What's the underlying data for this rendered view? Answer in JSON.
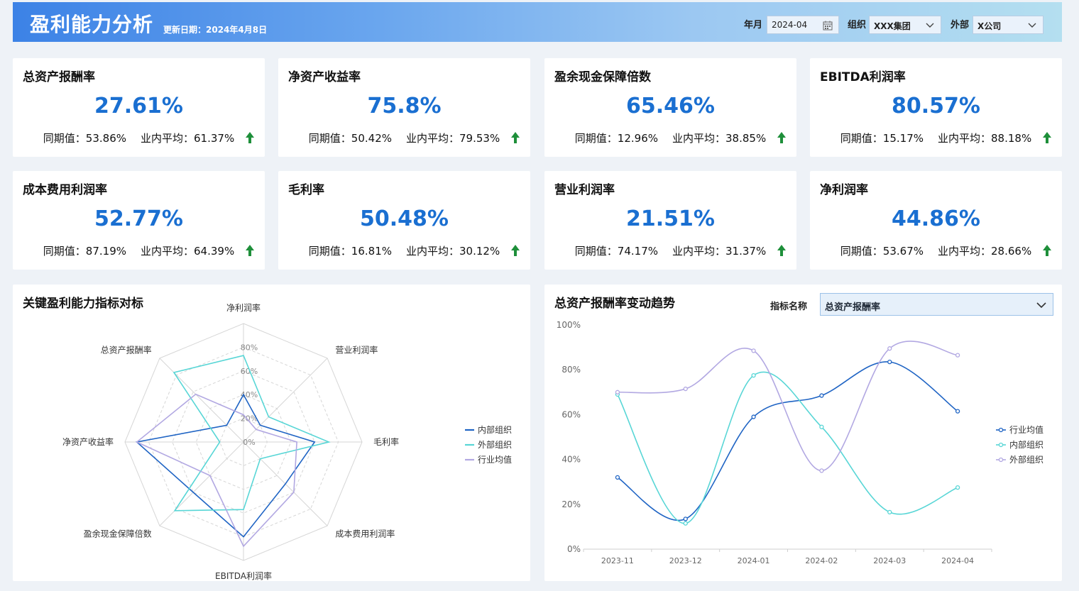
{
  "header": {
    "title": "盈利能力分析",
    "update_text": "更新日期：2024年4月8日",
    "filters": [
      {
        "label": "年月",
        "value": "2024-04",
        "icon": "calendar-icon"
      },
      {
        "label": "组织",
        "value": "XXX集团",
        "icon": "chevron-down-icon"
      },
      {
        "label": "外部",
        "value": "X公司",
        "icon": "chevron-down-icon"
      }
    ]
  },
  "kpis": [
    {
      "name": "总资产报酬率",
      "value": "27.61%",
      "prev": "同期值：53.86%",
      "avg": "业内平均：61.37%",
      "trend": "up"
    },
    {
      "name": "净资产收益率",
      "value": "75.8%",
      "prev": "同期值：50.42%",
      "avg": "业内平均：79.53%",
      "trend": "up"
    },
    {
      "name": "盈余现金保障倍数",
      "value": "65.46%",
      "prev": "同期值：12.96%",
      "avg": "业内平均：38.85%",
      "trend": "up"
    },
    {
      "name": "EBITDA利润率",
      "value": "80.57%",
      "prev": "同期值：15.17%",
      "avg": "业内平均：88.18%",
      "trend": "up"
    },
    {
      "name": "成本费用利润率",
      "value": "52.77%",
      "prev": "同期值：87.19%",
      "avg": "业内平均：64.39%",
      "trend": "up"
    },
    {
      "name": "毛利率",
      "value": "50.48%",
      "prev": "同期值：16.81%",
      "avg": "业内平均：30.12%",
      "trend": "up"
    },
    {
      "name": "营业利润率",
      "value": "21.51%",
      "prev": "同期值：74.17%",
      "avg": "业内平均：31.37%",
      "trend": "up"
    },
    {
      "name": "净利润率",
      "value": "44.86%",
      "prev": "同期值：53.67%",
      "avg": "业内平均：28.66%",
      "trend": "up"
    }
  ],
  "colors": {
    "accent": "#1a6fd1",
    "up": "#1e8f3a",
    "dark_blue": "#1f64c4",
    "teal": "#58d6d6",
    "lavender": "#b2a8e2"
  },
  "radar_panel": {
    "title": "关键盈利能力指标对标"
  },
  "trend_panel": {
    "title": "总资产报酬率变动趋势",
    "selector_label": "指标名称",
    "selector_value": "总资产报酬率"
  },
  "chart_data": [
    {
      "type": "radar",
      "title": "关键盈利能力指标对标",
      "axes": [
        "净利润率",
        "营业利润率",
        "毛利率",
        "成本费用利润率",
        "EBITDA利润率",
        "盈余现金保障倍数",
        "净资产收益率",
        "总资产报酬率"
      ],
      "radial_ticks": [
        "0%",
        "20%",
        "40%",
        "60%",
        "80%"
      ],
      "range": [
        0,
        100
      ],
      "legend": "right",
      "series": [
        {
          "name": "内部组织",
          "color": "#1f64c4",
          "values": [
            40,
            20,
            60,
            50,
            80,
            60,
            90,
            20
          ]
        },
        {
          "name": "外部组织",
          "color": "#58d6d6",
          "values": [
            73,
            30,
            72,
            20,
            57,
            82,
            20,
            83
          ]
        },
        {
          "name": "行业均值",
          "color": "#b2a8e2",
          "values": [
            23,
            15,
            45,
            60,
            88,
            40,
            90,
            57
          ]
        }
      ]
    },
    {
      "type": "line",
      "title": "总资产报酬率变动趋势",
      "x": [
        "2023-11",
        "2023-12",
        "2024-01",
        "2024-02",
        "2024-03",
        "2024-04"
      ],
      "y_ticks": [
        "0%",
        "20%",
        "40%",
        "60%",
        "80%",
        "100%"
      ],
      "ylim": [
        0,
        100
      ],
      "smooth": true,
      "legend": "right",
      "series": [
        {
          "name": "行业均值",
          "color": "#1f64c4",
          "values": [
            32,
            13.5,
            59,
            68.5,
            83.5,
            61.5
          ]
        },
        {
          "name": "内部组织",
          "color": "#58d6d6",
          "values": [
            69,
            11.5,
            77.5,
            54.5,
            16.5,
            27.5
          ]
        },
        {
          "name": "外部组织",
          "color": "#b2a8e2",
          "values": [
            70,
            71.5,
            88.5,
            35,
            89.5,
            86.5
          ]
        }
      ]
    }
  ]
}
